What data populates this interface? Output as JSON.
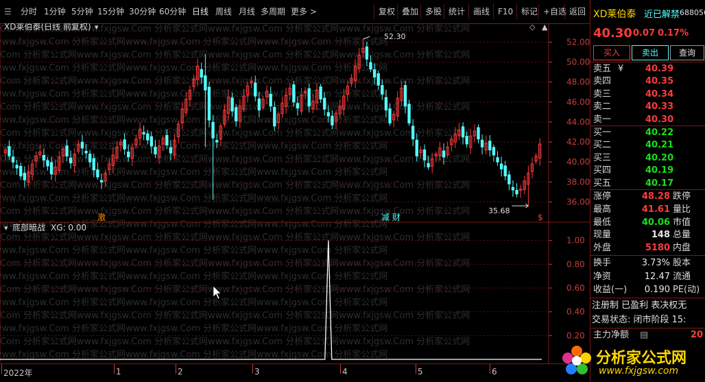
{
  "toolbar": {
    "periods": [
      "分时",
      "1分钟",
      "5分钟",
      "15分钟",
      "30分钟",
      "60分钟",
      "日线",
      "周线",
      "月线",
      "多周期"
    ],
    "more_label": "更多 >",
    "tools": [
      "复权",
      "叠加",
      "多股",
      "统计",
      "画线",
      "F10",
      "标记",
      "+自选",
      "返回"
    ]
  },
  "main_chart": {
    "title": "XD莱伯泰(日线 前复权)",
    "high_label": "52.30",
    "low_label": "35.68",
    "price_ticks": [
      "52.00",
      "50.00",
      "48.00",
      "46.00",
      "44.00",
      "42.00",
      "40.00",
      "38.00",
      "36.00"
    ],
    "markers": {
      "left": "激",
      "mid": "减 财",
      "right": "$"
    }
  },
  "indicator": {
    "title": "底部暗战",
    "value_label": "XG: 0.00",
    "ticks": [
      "1.00",
      "0.80",
      "0.60",
      "0.40",
      "0.20"
    ]
  },
  "date_axis": {
    "labels": [
      "2022年",
      "1",
      "2",
      "3",
      "4",
      "5",
      "6"
    ]
  },
  "watermark": "Com 分析家公式网www.fxjgsw.Com 分析家公式网www.fxjgsw.Com 分析家公式网www.fxjgsw.Com 分析家公式网",
  "panel": {
    "stock_name": "XD莱伯泰",
    "news_label": "近已解禁",
    "code": "688056",
    "price": "40.30",
    "change": "0.07",
    "change_pct": "0.17%",
    "buttons": {
      "buy": "买入",
      "sell": "卖出",
      "query": "查询"
    },
    "asks": [
      {
        "label": "卖五",
        "mark": "¥",
        "price": "40.39"
      },
      {
        "label": "卖四",
        "mark": "",
        "price": "40.35"
      },
      {
        "label": "卖三",
        "mark": "",
        "price": "40.34"
      },
      {
        "label": "卖二",
        "mark": "",
        "price": "40.33"
      },
      {
        "label": "卖一",
        "mark": "",
        "price": "40.30"
      }
    ],
    "bids": [
      {
        "label": "买一",
        "price": "40.22"
      },
      {
        "label": "买二",
        "price": "40.21"
      },
      {
        "label": "买三",
        "price": "40.20"
      },
      {
        "label": "买四",
        "price": "40.19"
      },
      {
        "label": "买五",
        "price": "40.17"
      }
    ],
    "stats1": [
      {
        "label": "涨停",
        "value": "48.28",
        "label2": "跌停",
        "color": "red"
      },
      {
        "label": "最高",
        "value": "41.61",
        "label2": "量比",
        "color": "red"
      },
      {
        "label": "最低",
        "value": "40.06",
        "label2": "市值",
        "color": "green"
      },
      {
        "label": "现量",
        "value": "148",
        "label2": "总量",
        "color": "white"
      },
      {
        "label": "外盘",
        "value": "5180",
        "label2": "内盘",
        "color": "red"
      }
    ],
    "stats2": [
      {
        "label": "换手",
        "value": "3.73%",
        "label2": "股本"
      },
      {
        "label": "净资",
        "value": "12.47",
        "label2": "流通"
      },
      {
        "label": "收益(一)",
        "value": "0.190",
        "label2": "PE(动)"
      }
    ],
    "info": {
      "reg": "注册制 已盈利 表决权无",
      "trade_status": "交易状态: 闭市阶段 15:",
      "main_force_label": "主力净额",
      "main_force_value": "20"
    },
    "logo_text": "分析家公式网",
    "logo_url": "www.fxjgsw.com"
  },
  "colors": {
    "up": "#ff3b3b",
    "down": "#54ffff",
    "bg": "#000000",
    "border": "#7a1a1a"
  },
  "chart_data": {
    "type": "candlestick",
    "price_range": [
      35.0,
      53.2
    ],
    "high_annotation": 52.3,
    "low_annotation": 35.68,
    "indicator_range": [
      0,
      1.05
    ],
    "indicator_signal_index": 84,
    "indicator_signal_value": 1.0
  }
}
